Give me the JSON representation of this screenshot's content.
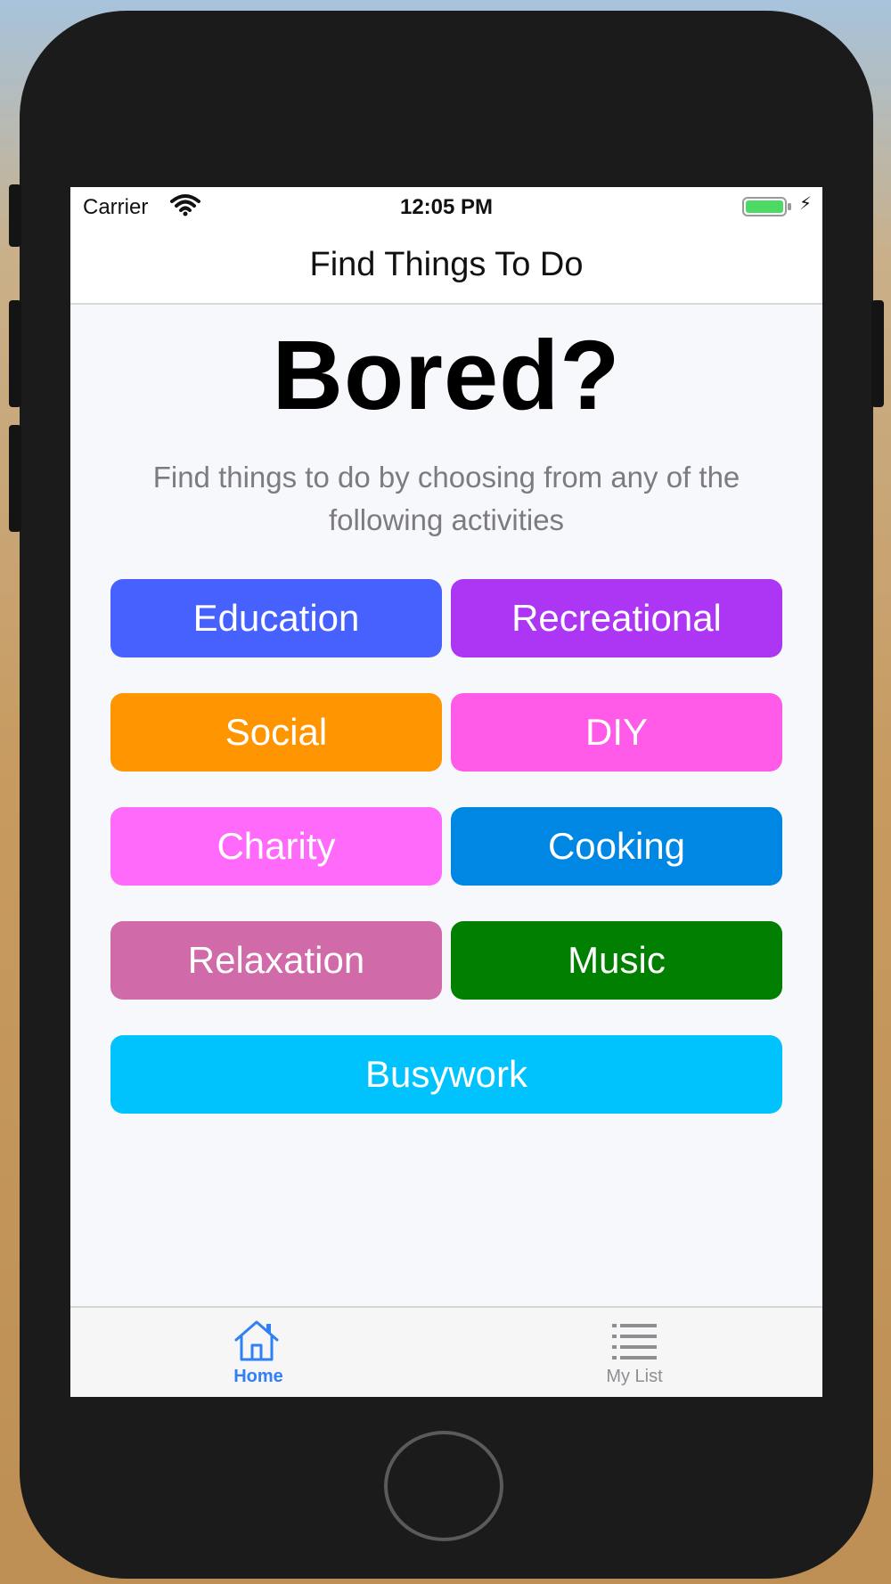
{
  "status_bar": {
    "carrier": "Carrier",
    "time": "12:05 PM",
    "wifi_icon": "wifi-icon",
    "battery_icon": "battery-charging-icon",
    "charging_symbol": "⚡"
  },
  "nav": {
    "title": "Find Things To Do"
  },
  "main": {
    "headline": "Bored?",
    "description": "Find things to do by choosing from any of the following activities",
    "categories": [
      {
        "label": "Education",
        "color": "#4761ff"
      },
      {
        "label": "Recreational",
        "color": "#ad35f4"
      },
      {
        "label": "Social",
        "color": "#ff9500"
      },
      {
        "label": "DIY",
        "color": "#ff5be8"
      },
      {
        "label": "Charity",
        "color": "#ff6afa"
      },
      {
        "label": "Cooking",
        "color": "#0087e3"
      },
      {
        "label": "Relaxation",
        "color": "#d06aa8"
      },
      {
        "label": "Music",
        "color": "#007f01"
      },
      {
        "label": "Busywork",
        "color": "#00c3fe"
      }
    ]
  },
  "tab_bar": {
    "tabs": [
      {
        "label": "Home",
        "icon": "home-icon",
        "active": true,
        "color": "#2f7ff6"
      },
      {
        "label": "My List",
        "icon": "list-icon",
        "active": false,
        "color": "#8e8e93"
      }
    ]
  }
}
